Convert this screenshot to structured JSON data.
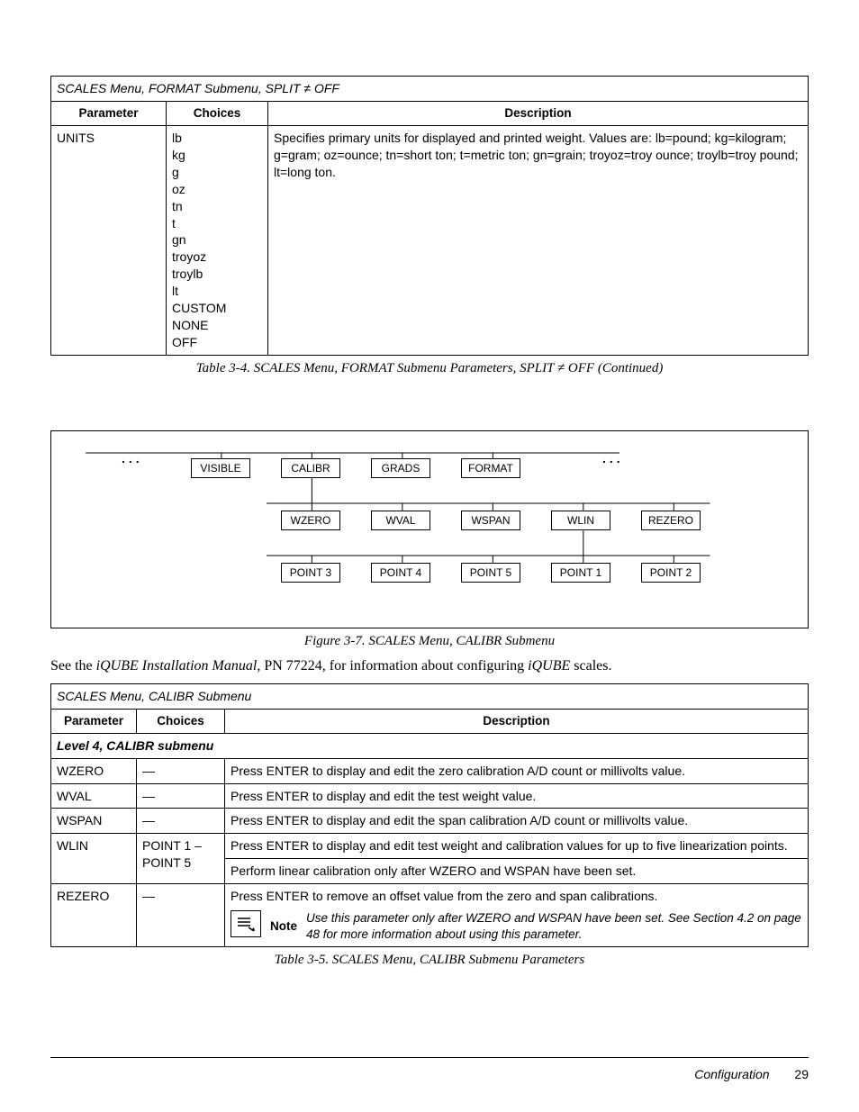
{
  "table1": {
    "title": "SCALES Menu, FORMAT Submenu, SPLIT ≠ OFF",
    "headers": {
      "parameter": "Parameter",
      "choices": "Choices",
      "description": "Description"
    },
    "row": {
      "parameter": "UNITS",
      "choices": "lb\nkg\ng\noz\ntn\nt\ngn\ntroyoz\ntroylb\nlt\nCUSTOM\nNONE\nOFF",
      "description": "Specifies primary units for displayed and printed weight. Values are: lb=pound; kg=kilogram; g=gram; oz=ounce; tn=short ton; t=metric ton; gn=grain; troyoz=troy ounce; troylb=troy pound; lt=long ton."
    },
    "caption": "Table 3-4. SCALES Menu, FORMAT Submenu Parameters, SPLIT ≠ OFF (Continued)"
  },
  "diagram": {
    "row1": {
      "n1": "VISIBLE",
      "n2": "CALIBR",
      "n3": "GRADS",
      "n4": "FORMAT"
    },
    "row2": {
      "n1": "WZERO",
      "n2": "WVAL",
      "n3": "WSPAN",
      "n4": "WLIN",
      "n5": "REZERO"
    },
    "row3": {
      "n1": "POINT 3",
      "n2": "POINT 4",
      "n3": "POINT 5",
      "n4": "POINT 1",
      "n5": "POINT 2"
    },
    "ellipsis": "...",
    "caption": "Figure 3-7. SCALES Menu, CALIBR Submenu"
  },
  "paragraph": {
    "pre": "See the ",
    "em1": "iQUBE Installation Manual",
    "mid": ", PN 77224, for information about configuring ",
    "em2": "iQUBE",
    "post": " scales."
  },
  "table2": {
    "title": "SCALES Menu, CALIBR Submenu",
    "headers": {
      "parameter": "Parameter",
      "choices": "Choices",
      "description": "Description"
    },
    "section": "Level 4, CALIBR submenu",
    "rows": {
      "wzero": {
        "param": "WZERO",
        "choices": "—",
        "desc": "Press ENTER to display and edit the zero calibration A/D count or millivolts value."
      },
      "wval": {
        "param": "WVAL",
        "choices": "—",
        "desc": "Press ENTER to display and edit the test weight value."
      },
      "wspan": {
        "param": "WSPAN",
        "choices": "—",
        "desc": "Press ENTER to display and edit the span calibration A/D count or millivolts value."
      },
      "wlin": {
        "param": "WLIN",
        "choices": "POINT 1 – POINT 5",
        "desc1": "Press ENTER to display and edit test weight and calibration values for up to five linearization points.",
        "desc2": "Perform linear calibration only after WZERO and WSPAN have been set."
      },
      "rezero": {
        "param": "REZERO",
        "choices": "—",
        "desc": "Press ENTER to remove an offset value from the zero and span calibrations.",
        "note_label": "Note",
        "note_text": "Use this parameter only after WZERO and WSPAN have been set. See Section 4.2 on page 48 for more information about using this parameter."
      }
    },
    "caption": "Table 3-5. SCALES Menu, CALIBR Submenu Parameters"
  },
  "footer": {
    "section": "Configuration",
    "page": "29"
  }
}
